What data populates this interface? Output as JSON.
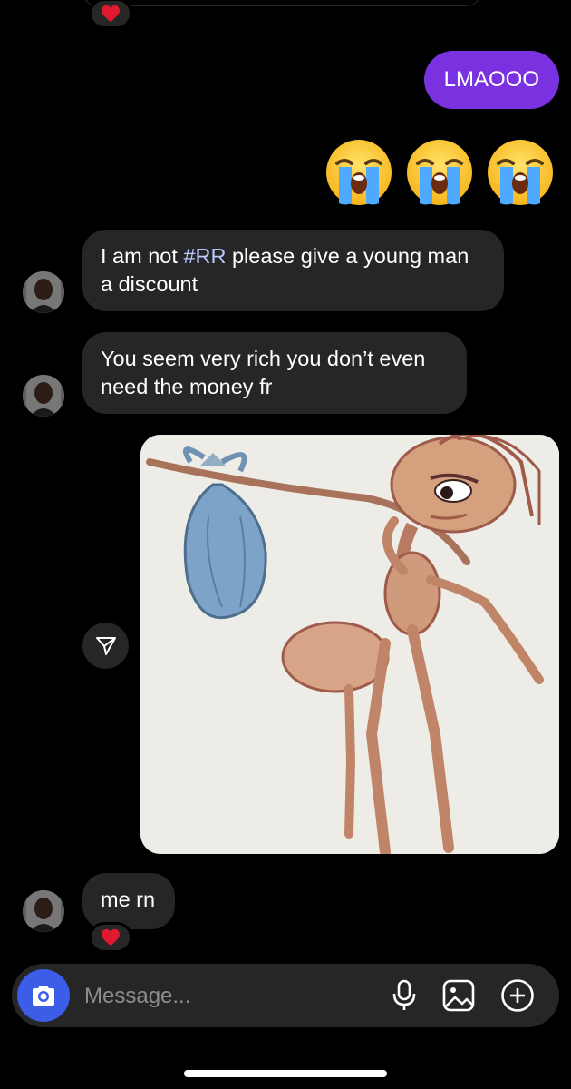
{
  "messages": {
    "outgoing_text": "LMAOOO",
    "incoming_1_pre": "I am not ",
    "incoming_1_tag": "#RR",
    "incoming_1_post": " please give a young man a discount",
    "incoming_2": "You seem very rich you don’t even need the money fr",
    "incoming_3": "me rn"
  },
  "emojis": [
    "loudly-crying-face",
    "loudly-crying-face",
    "loudly-crying-face"
  ],
  "reactions": [
    "red-heart",
    "red-heart"
  ],
  "composer": {
    "placeholder": "Message..."
  },
  "colors": {
    "outgoing_bubble": "#7a31e0",
    "incoming_bubble": "#262626",
    "camera_button": "#3b5de7",
    "background": "#000000"
  }
}
